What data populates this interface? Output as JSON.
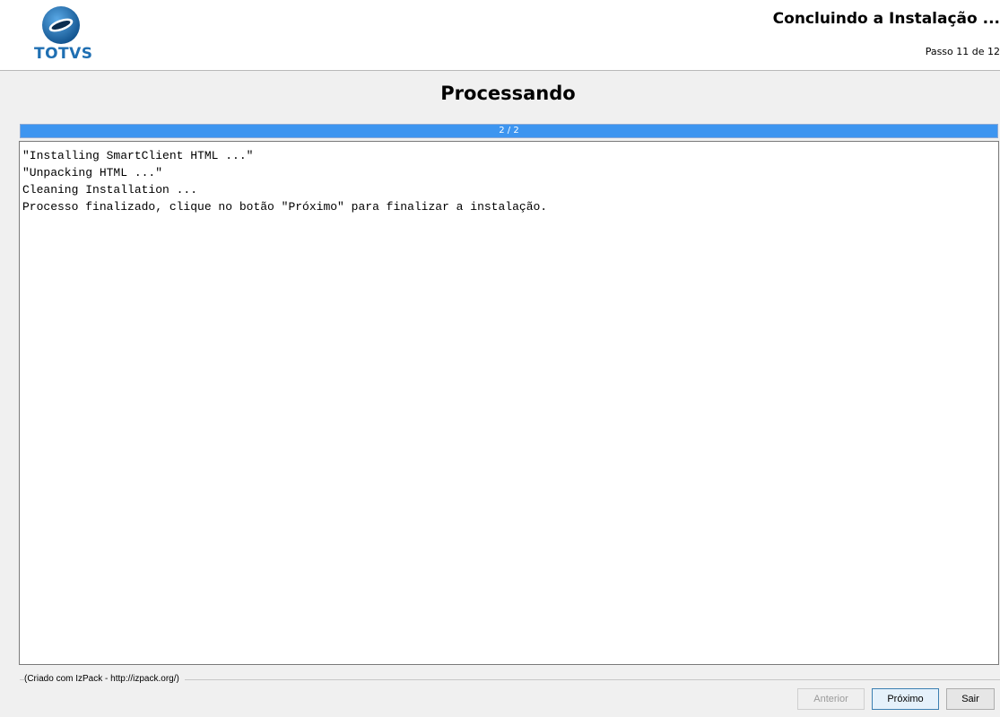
{
  "header": {
    "logo_text": "TOTVS",
    "step_title": "Concluindo a Instalação ...",
    "step_counter": "Passo 11 de 12"
  },
  "panel": {
    "title": "Processando",
    "progress": {
      "label": "2 / 2",
      "fraction": 1.0
    },
    "log_lines": [
      "\"Installing SmartClient HTML ...\"",
      "\"Unpacking HTML ...\"",
      "Cleaning Installation ...",
      "Processo finalizado, clique no botão \"Próximo\" para finalizar a instalação."
    ]
  },
  "footer": {
    "credit": "(Criado com IzPack - http://izpack.org/)",
    "buttons": {
      "previous": "Anterior",
      "next": "Próximo",
      "exit": "Sair"
    }
  },
  "colors": {
    "progress_fill": "#3d95f0",
    "logo_blue": "#1f6fb2",
    "logo_dark": "#0b2d4f"
  }
}
